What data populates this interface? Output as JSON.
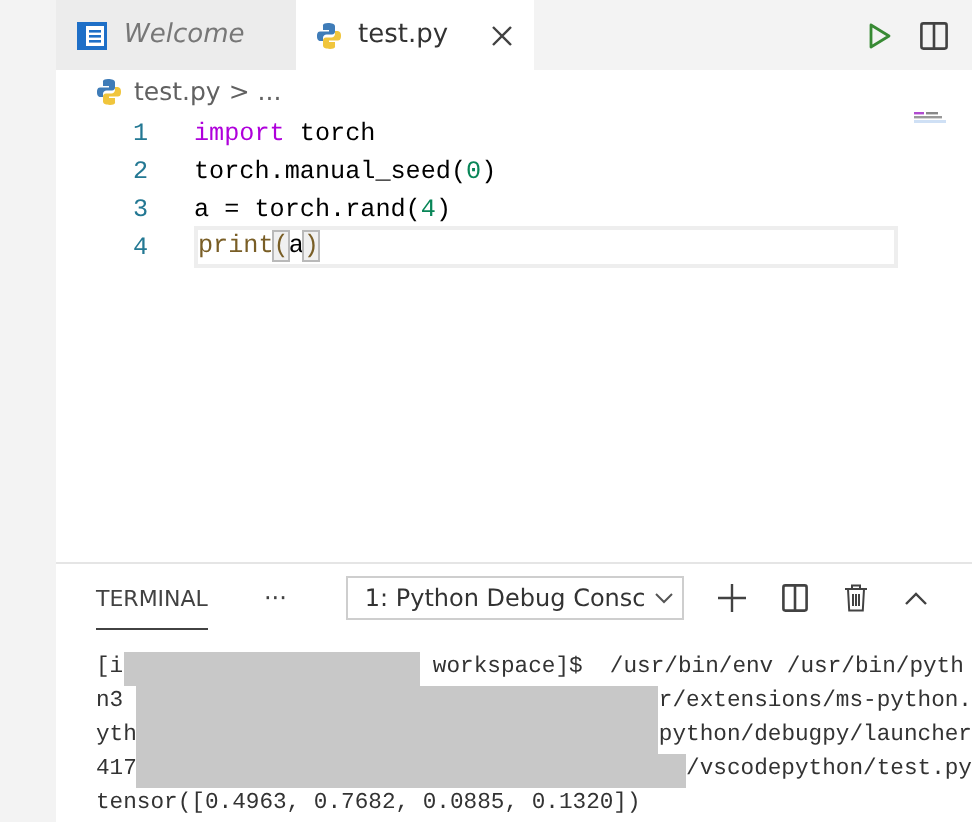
{
  "tabs": [
    {
      "label": "Welcome",
      "kind": "welcome",
      "selected": false
    },
    {
      "label": "test.py",
      "kind": "python",
      "selected": true
    }
  ],
  "breadcrumb": {
    "file": "test.py",
    "separator": ">",
    "more": "..."
  },
  "code_lines": [
    {
      "number": "1",
      "current": false,
      "tokens": [
        {
          "kind": "keyword",
          "text": "import"
        },
        {
          "kind": "plain",
          "text": " torch"
        }
      ]
    },
    {
      "number": "2",
      "current": false,
      "tokens": [
        {
          "kind": "plain",
          "text": "torch.manual_seed("
        },
        {
          "kind": "number",
          "text": "0"
        },
        {
          "kind": "plain",
          "text": ")"
        }
      ]
    },
    {
      "number": "3",
      "current": false,
      "tokens": [
        {
          "kind": "plain",
          "text": "a = torch.rand("
        },
        {
          "kind": "number",
          "text": "4"
        },
        {
          "kind": "plain",
          "text": ")"
        }
      ]
    },
    {
      "number": "4",
      "current": true,
      "tokens": [
        {
          "kind": "function",
          "text": "print"
        },
        {
          "kind": "bracket",
          "text": "(",
          "matched": true
        },
        {
          "kind": "plain",
          "text": "a"
        },
        {
          "kind": "bracket",
          "text": ")",
          "matched": true
        }
      ]
    }
  ],
  "panel": {
    "tabs": [
      {
        "label": "TERMINAL",
        "selected": true
      }
    ],
    "more": "···",
    "terminal_select": {
      "value": "1: Python Debug Consc"
    },
    "terminal_lines": [
      {
        "before": "[i",
        "redacted": true,
        "after": " workspace]$  /usr/bin/env /usr/bin/pyth"
      },
      {
        "before": "n3 ",
        "redacted": true,
        "after": "r/extensions/ms-python."
      },
      {
        "before": "yth",
        "redacted": true,
        "after": "python/debugpy/launcher"
      },
      {
        "before": "417",
        "redacted": true,
        "after": "/vscodepython/test.py"
      },
      {
        "before": "tensor([0.4963, 0.7682, 0.0885, 0.1320])",
        "redacted": false
      }
    ]
  }
}
